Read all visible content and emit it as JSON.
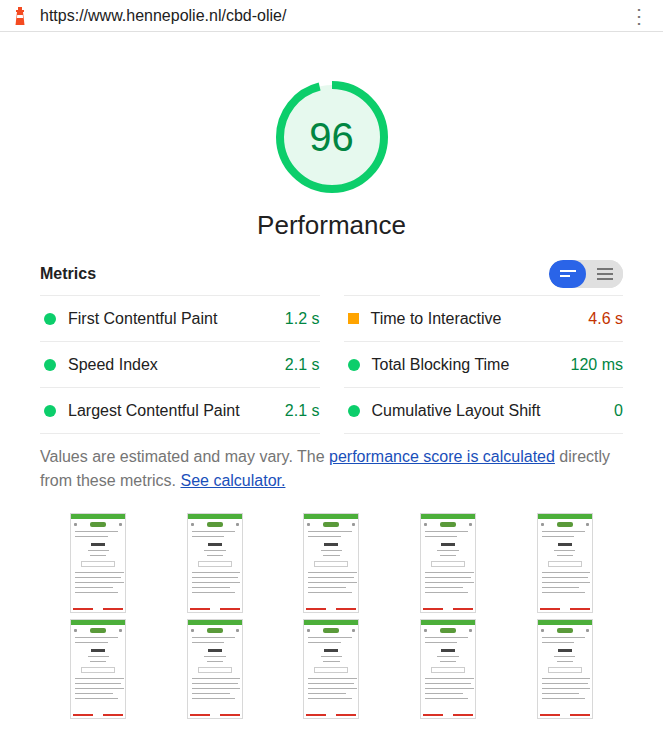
{
  "address_bar": {
    "url": "https://www.hennepolie.nl/cbd-olie/",
    "menu": "⋮"
  },
  "gauge": {
    "score": "96",
    "level": 0.96,
    "label": "Performance"
  },
  "metrics_header": {
    "title": "Metrics"
  },
  "view_toggle": [
    {
      "view": "compact",
      "selected": true
    },
    {
      "view": "expanded",
      "selected": false
    }
  ],
  "metrics": [
    {
      "label": "First Contentful Paint",
      "value": "1.2 s",
      "kind": "pass"
    },
    {
      "label": "Speed Index",
      "value": "2.1 s",
      "kind": "pass"
    },
    {
      "label": "Largest Contentful Paint",
      "value": "2.1 s",
      "kind": "pass"
    },
    {
      "label": "Time to Interactive",
      "value": "4.6 s",
      "kind": "average"
    },
    {
      "label": "Total Blocking Time",
      "value": "120 ms",
      "kind": "pass"
    },
    {
      "label": "Cumulative Layout Shift",
      "value": "0",
      "kind": "pass"
    }
  ],
  "description": [
    {
      "kind": "text",
      "text": "Values are estimated and may vary. The "
    },
    {
      "kind": "link",
      "text": "performance score is calculated"
    },
    {
      "kind": "text",
      "text": " directly from these metrics. "
    },
    {
      "kind": "link",
      "text": "See calculator."
    }
  ],
  "filmstrip": {
    "frame_count": 10
  }
}
